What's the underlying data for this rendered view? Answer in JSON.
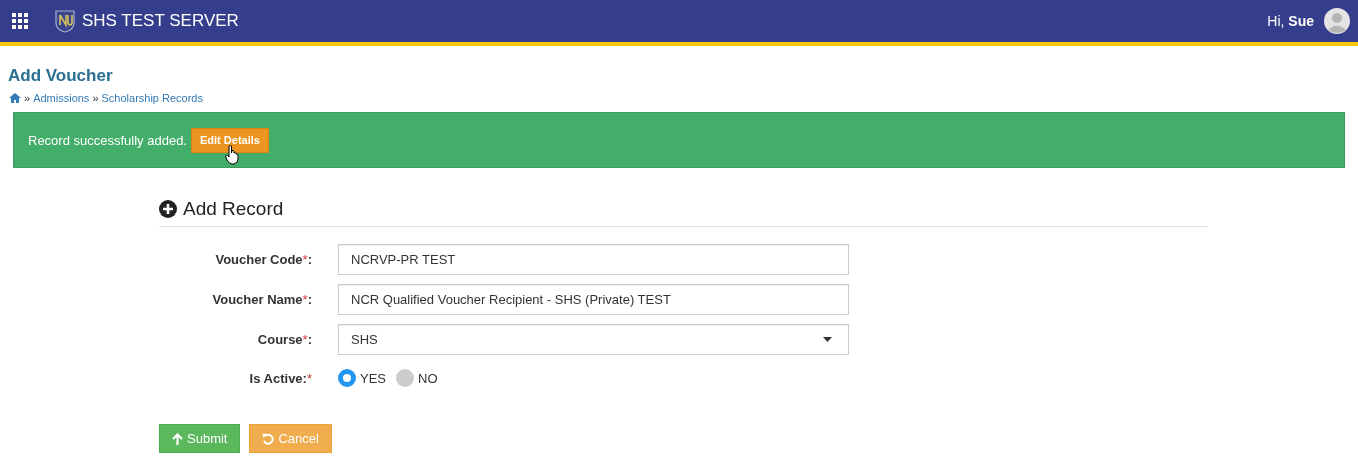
{
  "header": {
    "title": "SHS TEST SERVER",
    "greeting": "Hi,",
    "user": "Sue"
  },
  "page": {
    "title": "Add Voucher",
    "breadcrumbs": [
      {
        "separator": "»",
        "label": "Admissions"
      },
      {
        "separator": "»",
        "label": "Scholarship Records"
      }
    ]
  },
  "alert": {
    "message": "Record successfully added.",
    "button": "Edit Details"
  },
  "form": {
    "title": "Add Record",
    "fields": [
      {
        "kind": "text",
        "label": "Voucher Code",
        "mark": "*",
        "after": ":",
        "value": "NCRVP-PR TEST"
      },
      {
        "kind": "text",
        "label": "Voucher Name",
        "mark": "*",
        "after": ":",
        "value": "NCR Qualified Voucher Recipient - SHS (Private) TEST"
      },
      {
        "kind": "select",
        "label": "Course",
        "mark": "*",
        "after": ":",
        "value": "SHS"
      },
      {
        "kind": "radio",
        "label": "Is Active:",
        "mark": "*",
        "options": [
          {
            "label": "YES",
            "selected": true
          },
          {
            "label": "NO",
            "selected": false
          }
        ]
      }
    ],
    "buttons": [
      {
        "kind": "submit",
        "label": "Submit"
      },
      {
        "kind": "cancel",
        "label": "Cancel"
      }
    ]
  }
}
